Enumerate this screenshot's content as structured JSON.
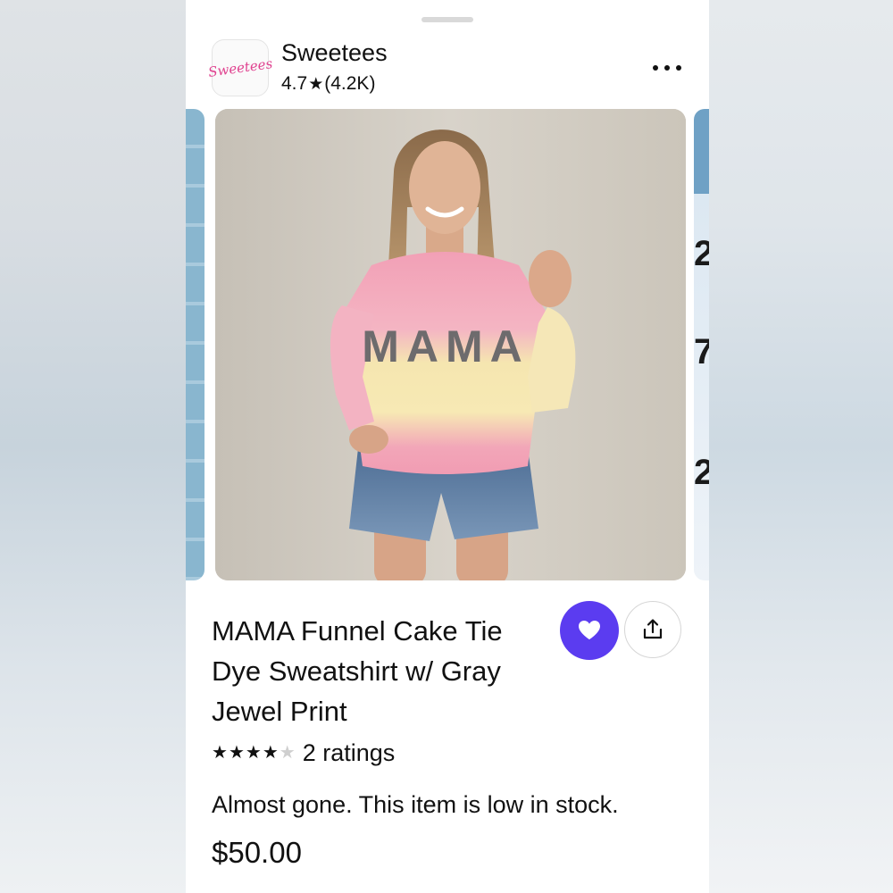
{
  "shop": {
    "logo_text": "Sweetees",
    "name": "Sweetees",
    "rating": "4.7",
    "rating_star": "★",
    "rating_count": "(4.2K)"
  },
  "product": {
    "shirt_text": "MAMA",
    "title": "MAMA Funnel Cake Tie Dye Sweatshirt w/ Gray Jewel Print",
    "stars": 4,
    "stars_total": 5,
    "ratings_label": "2 ratings",
    "stock_message": "Almost gone. This item is low in stock.",
    "price": "$50.00",
    "favorited": true
  },
  "colors": {
    "accent": "#5b3cf0",
    "text": "#111111"
  },
  "icons": {
    "more": "more-horizontal-icon",
    "favorite": "heart-icon",
    "share": "share-icon",
    "star": "star-icon"
  }
}
